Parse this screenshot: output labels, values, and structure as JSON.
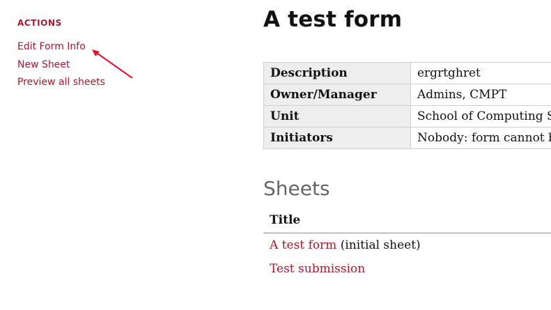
{
  "sidebar": {
    "heading": "ACTIONS",
    "links": [
      {
        "label": "Edit Form Info"
      },
      {
        "label": "New Sheet"
      },
      {
        "label": "Preview all sheets"
      }
    ]
  },
  "main": {
    "title": "A test form",
    "info_rows": [
      {
        "key": "Description",
        "value": "ergrtghret"
      },
      {
        "key": "Owner/Manager",
        "value": "Admins, CMPT"
      },
      {
        "key": "Unit",
        "value": "School of Computing Science"
      },
      {
        "key": "Initiators",
        "value": "Nobody: form cannot be filled out"
      }
    ],
    "sheets_heading": "Sheets",
    "sheets_table": {
      "header": "Title",
      "rows": [
        {
          "link": "A test form",
          "note": "(initial sheet)"
        },
        {
          "link": "Test submission",
          "note": ""
        }
      ]
    }
  },
  "colors": {
    "accent": "#a6192e",
    "arrow": "#e8102a"
  }
}
